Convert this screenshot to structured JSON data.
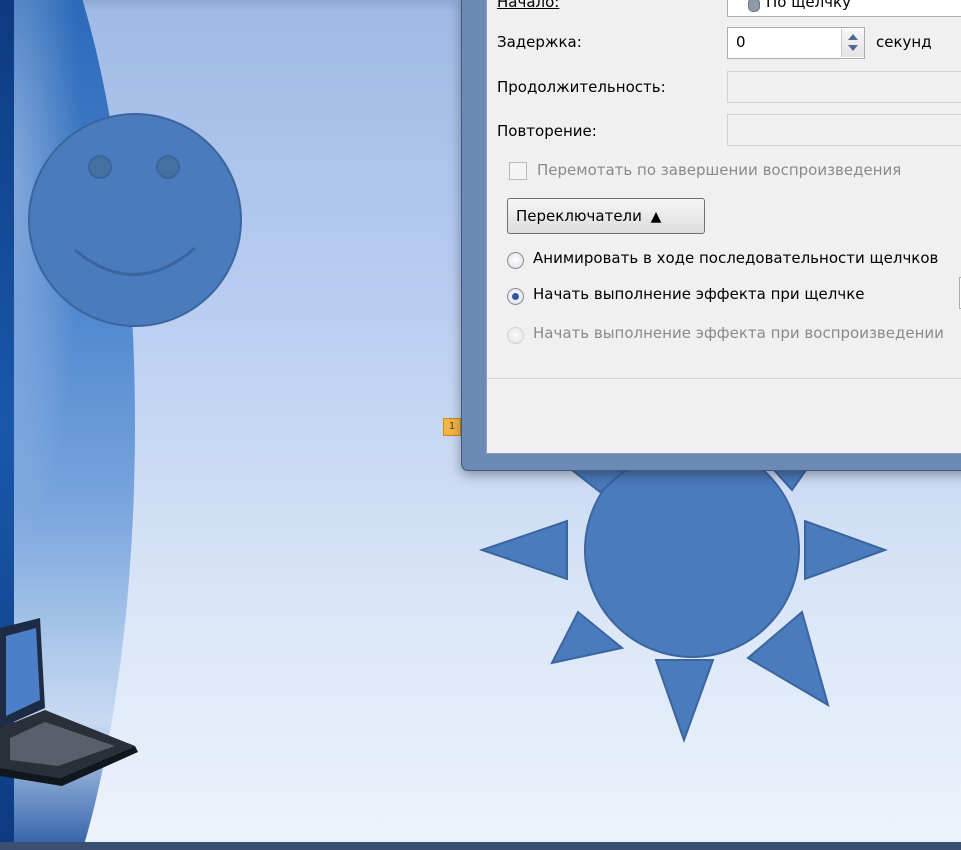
{
  "dialog": {
    "start_label": "Начало:",
    "start_value": "По щелчку",
    "delay_label": "Задержка:",
    "delay_value": "0",
    "delay_unit": "секунд",
    "duration_label": "Продолжительность:",
    "repeat_label": "Повторение:",
    "rewind_label": "Перемотать по завершении воспроизведения",
    "triggers_button": "Переключатели",
    "options": [
      {
        "label": "Анимировать в ходе последовательности щелчков",
        "selected": false,
        "enabled": true
      },
      {
        "label": "Начать выполнение эффекта при щелчке",
        "selected": true,
        "enabled": true
      },
      {
        "label": "Начать выполнение эффекта при воспроизведении",
        "selected": false,
        "enabled": false
      }
    ]
  },
  "slide": {
    "marker": "1",
    "shape_color": "#4a7bbd",
    "shape_outline": "#3b659e"
  }
}
